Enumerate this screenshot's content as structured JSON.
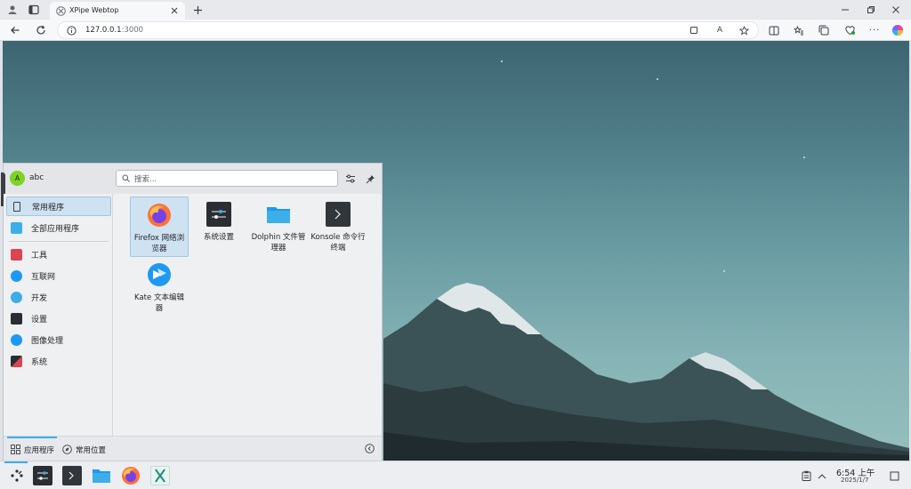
{
  "browser": {
    "tab_title": "XPipe Webtop",
    "url": "127.0.0.1:3000",
    "url_host": "127.0.0.1",
    "url_port": ":3000"
  },
  "launcher": {
    "user_initial": "A",
    "username": "abc",
    "search_placeholder": "搜索...",
    "categories": [
      {
        "label": "常用程序"
      },
      {
        "label": "全部应用程序"
      },
      {
        "label": "工具"
      },
      {
        "label": "互联网"
      },
      {
        "label": "开发"
      },
      {
        "label": "设置"
      },
      {
        "label": "图像处理"
      },
      {
        "label": "系统"
      }
    ],
    "apps": [
      {
        "label": "Firefox 网络浏览器"
      },
      {
        "label": "系统设置"
      },
      {
        "label": "Dolphin 文件管理器"
      },
      {
        "label": "Konsole 命令行终端"
      },
      {
        "label": "Kate 文本编辑器"
      }
    ],
    "footer": {
      "applications": "应用程序",
      "places": "常用位置"
    }
  },
  "taskbar": {
    "time": "6:54 上午",
    "date": "2025/1/7"
  },
  "colors": {
    "accent": "#3daee9",
    "selected_bg": "#cfe2f1",
    "sky_top": "#3d6572",
    "sky_bottom": "#97c0bf"
  }
}
